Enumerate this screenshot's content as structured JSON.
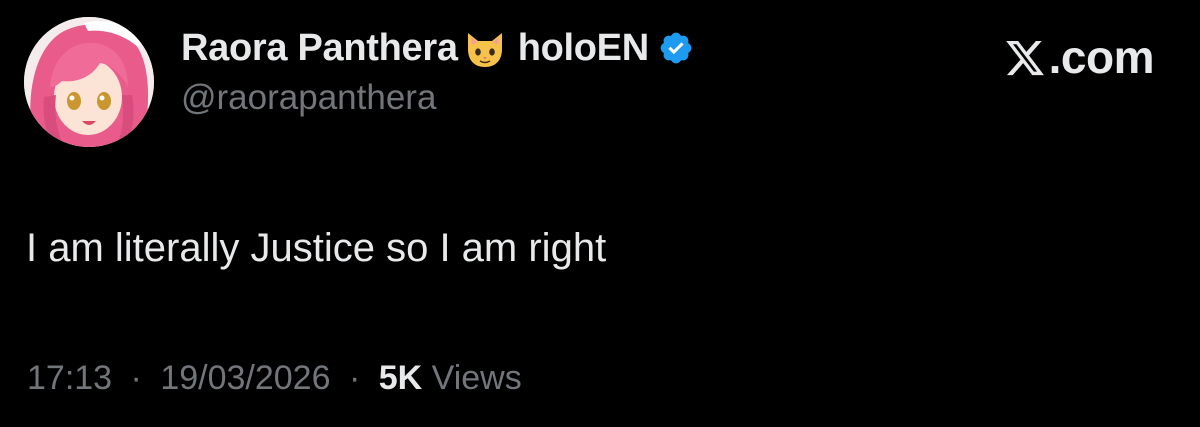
{
  "author": {
    "display_name": "Raora Panthera",
    "emoji": "cat-face-emoji",
    "affiliation": "holoEN",
    "verified": true,
    "handle": "@raorapanthera",
    "avatar": "avatar-pink-haired-anime-character"
  },
  "brand": {
    "logo": "x-logo-icon",
    "text": ".com"
  },
  "tweet": {
    "text": "I am literally Justice so I am right"
  },
  "meta": {
    "time": "17:13",
    "separator": "·",
    "date": "19/03/2026",
    "views_count": "5K",
    "views_label": "Views"
  },
  "colors": {
    "background": "#000000",
    "primary_text": "#e7e9ea",
    "secondary_text": "#71767b",
    "verified_blue": "#1d9bf0"
  }
}
